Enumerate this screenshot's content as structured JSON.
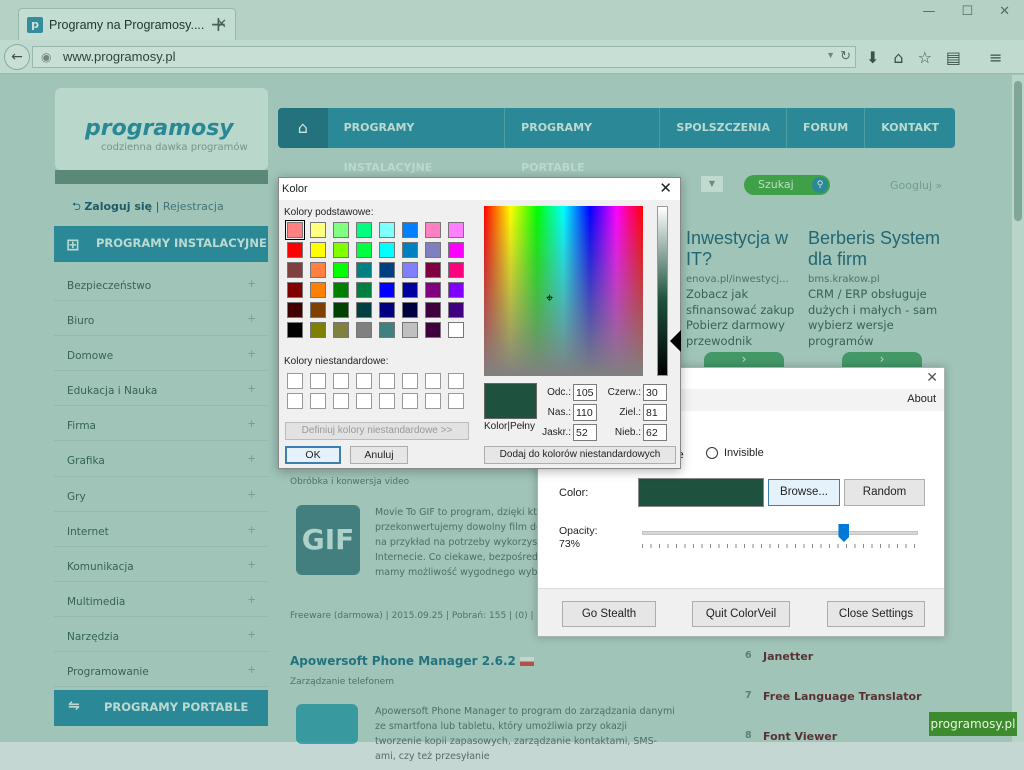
{
  "browser": {
    "tab_title": "Programy na Programosy....",
    "url": "www.programosy.pl",
    "favicon_letter": "p",
    "icons": [
      "back-icon",
      "globe-icon",
      "reload-icon",
      "download-icon",
      "home-icon",
      "star-icon",
      "bookmarks-icon",
      "menu-icon"
    ]
  },
  "site": {
    "logo_text": "programosy",
    "logo_sub": "codzienna dawka programów",
    "nav": [
      "PROGRAMY INSTALACYJNE",
      "PROGRAMY PORTABLE",
      "SPOLSZCZENIA",
      "FORUM",
      "KONTAKT"
    ],
    "login": "Zaloguj się",
    "register": "Rejestracja",
    "search_button": "Szukaj",
    "googluj": "Googluj",
    "sidebar_header": "PROGRAMY INSTALACYJNE",
    "categories": [
      "Bezpieczeństwo",
      "Biuro",
      "Domowe",
      "Edukacja i Nauka",
      "Firma",
      "Grafika",
      "Gry",
      "Internet",
      "Komunikacja",
      "Multimedia",
      "Narzędzia",
      "Programowanie"
    ],
    "portable_header": "PROGRAMY PORTABLE",
    "ad1": {
      "title": "Inwestycja w IT?",
      "url": "enova.pl/inwestycj...",
      "text": "Zobacz jak sfinansować zakup Pobierz darmowy przewodnik"
    },
    "ad2": {
      "title": "Berberis System dla firm",
      "url": "bms.krakow.pl",
      "text": "CRM / ERP obsługuje dużych i małych - sam wybierz wersje programów"
    },
    "article1": {
      "category": "Obróbka i konwersja video",
      "text": "Movie To GIF to program, dzięki które przekonwertujemy dowolny film do for na przykład na potrzeby wykorzystan Internecie. Co ciekawe, bezpośredni mamy możliwość wygodnego wybrani",
      "meta": "Freeware (darmowa) | 2015.09.25 | Pobrań: 155 | (0) |",
      "icon_label": "GIF"
    },
    "article2": {
      "title": "Apowersoft Phone Manager 2.6.2",
      "category": "Zarządzanie telefonem",
      "text": "Apowersoft Phone Manager to program do zarządzania danymi ze smartfona lub tabletu, który umożliwia przy okazji tworzenie kopii zapasowych, zarządzanie kontaktami, SMS-ami, czy też przesyłanie"
    },
    "right_list": [
      {
        "n": "6",
        "name": "Janetter"
      },
      {
        "n": "7",
        "name": "Free Language Translator"
      },
      {
        "n": "8",
        "name": "Font Viewer"
      }
    ],
    "promo": "programosy.pl"
  },
  "colorveil": {
    "about": "About",
    "partial_label": "e",
    "invisible_label": "Invisible",
    "color_label": "Color:",
    "color_value": "#1e513e",
    "browse_label": "Browse...",
    "random_label": "Random",
    "opacity_label": "Opacity:",
    "opacity_value": "73%",
    "opacity_fraction": 0.73,
    "go_stealth": "Go Stealth",
    "quit": "Quit ColorVeil",
    "close_settings": "Close Settings"
  },
  "kolor": {
    "title": "Kolor",
    "basic_label": "Kolory podstawowe:",
    "custom_label": "Kolory niestandardowe:",
    "define_button": "Definiuj kolory niestandardowe >>",
    "ok": "OK",
    "cancel": "Anuluj",
    "solid_label": "Kolor|Pełny",
    "add_button": "Dodaj do kolorów niestandardowych",
    "fields": {
      "hue_label": "Odc.:",
      "hue": "105",
      "sat_label": "Nas.:",
      "sat": "110",
      "lum_label": "Jaskr.:",
      "lum": "52",
      "red_label": "Czerw.:",
      "red": "30",
      "green_label": "Ziel.:",
      "green": "81",
      "blue_label": "Nieb.:",
      "blue": "62"
    },
    "basic_colors": [
      "#ff8080",
      "#ffff80",
      "#80ff80",
      "#00ff80",
      "#80ffff",
      "#0080ff",
      "#ff80c0",
      "#ff80ff",
      "#ff0000",
      "#ffff00",
      "#80ff00",
      "#00ff40",
      "#00ffff",
      "#0080c0",
      "#8080c0",
      "#ff00ff",
      "#804040",
      "#ff8040",
      "#00ff00",
      "#008080",
      "#004080",
      "#8080ff",
      "#800040",
      "#ff0080",
      "#800000",
      "#ff8000",
      "#008000",
      "#008040",
      "#0000ff",
      "#0000a0",
      "#800080",
      "#8000ff",
      "#400000",
      "#804000",
      "#004000",
      "#004040",
      "#000080",
      "#000040",
      "#400040",
      "#400080",
      "#000000",
      "#808000",
      "#808040",
      "#808080",
      "#408080",
      "#c0c0c0",
      "#400040",
      "#ffffff"
    ]
  }
}
